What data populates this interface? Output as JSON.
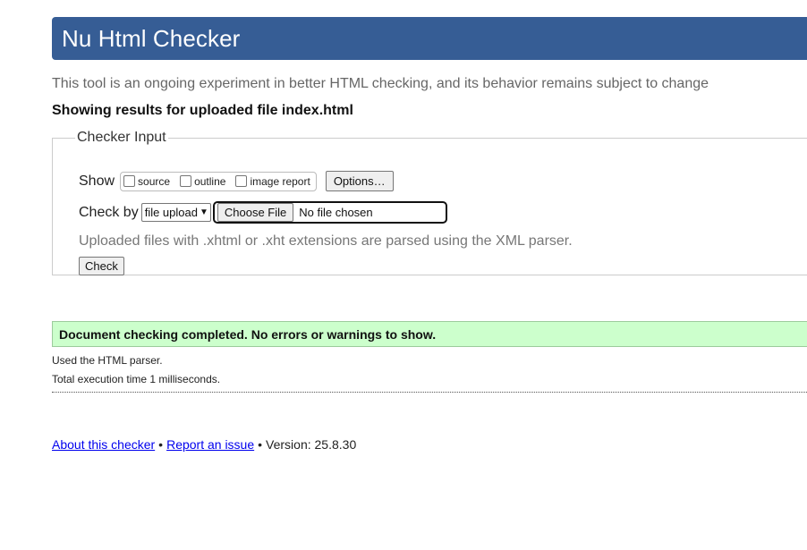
{
  "header": {
    "title": "Nu Html Checker"
  },
  "intro": {
    "text": "This tool is an ongoing experiment in better HTML checking, and its behavior remains subject to change"
  },
  "results_heading": "Showing results for uploaded file index.html",
  "checker_input": {
    "legend": "Checker Input",
    "show_label": "Show",
    "show_options": [
      {
        "label": "source",
        "checked": false
      },
      {
        "label": "outline",
        "checked": false
      },
      {
        "label": "image report",
        "checked": false
      }
    ],
    "options_button": "Options…",
    "check_by_label": "Check by",
    "check_by_selected": "file upload",
    "choose_file_button": "Choose File",
    "no_file_text": "No file chosen",
    "hint": "Uploaded files with .xhtml or .xht extensions are parsed using the XML parser.",
    "check_button": "Check"
  },
  "result": {
    "message": "Document checking completed. No errors or warnings to show.",
    "parser_note": "Used the HTML parser.",
    "execution_time": "Total execution time 1 milliseconds."
  },
  "footer": {
    "about_link": "About this checker",
    "separator": "•",
    "report_link": "Report an issue",
    "version": "Version: 25.8.30"
  },
  "colors": {
    "header_bg": "#365d95",
    "success_bg": "#ccffcc"
  }
}
